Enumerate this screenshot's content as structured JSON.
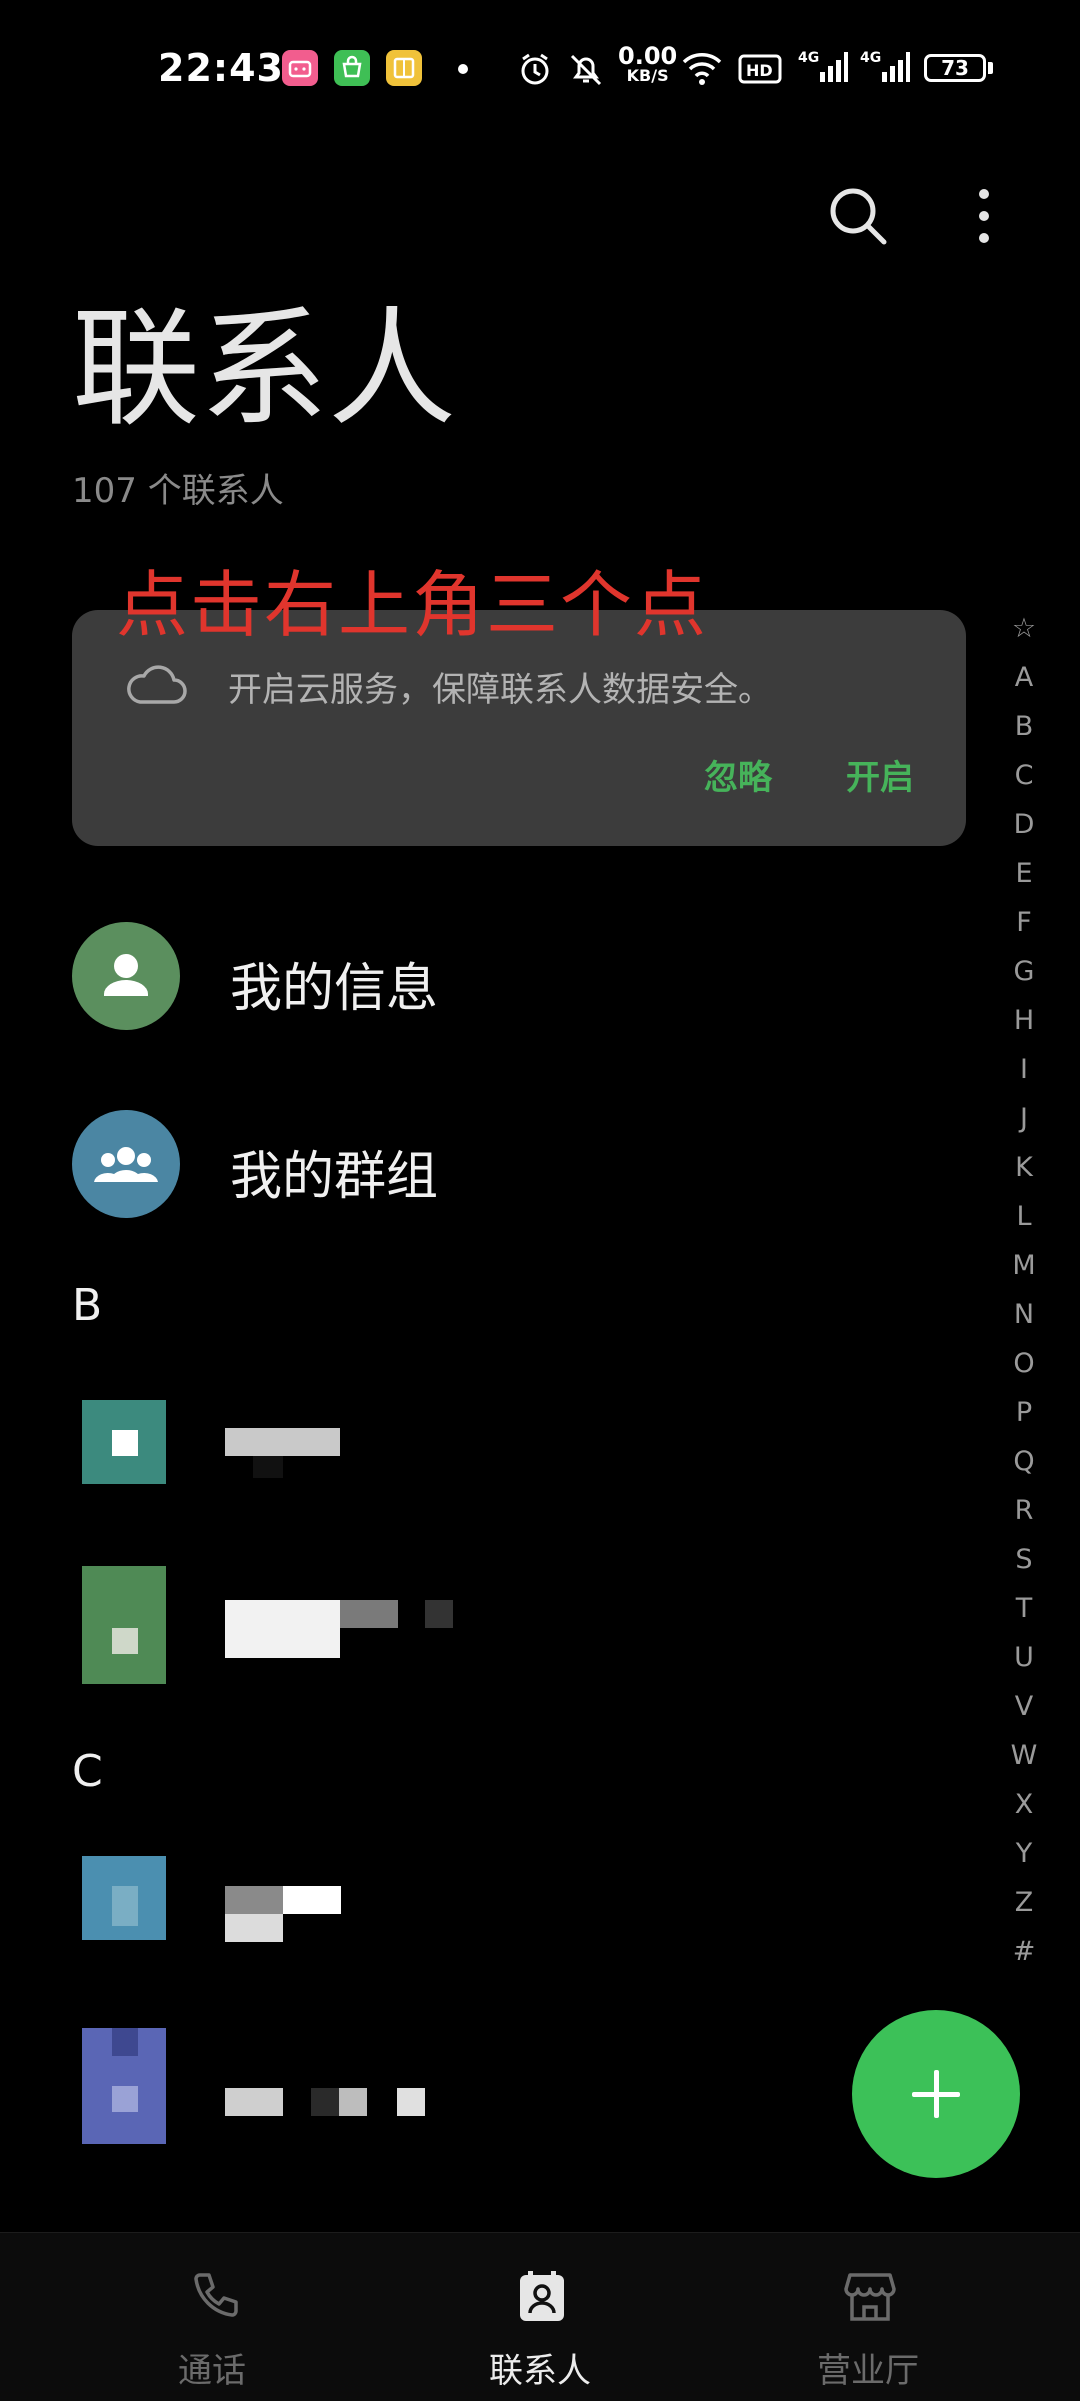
{
  "status_bar": {
    "time": "22:43",
    "net_speed_value": "0.00",
    "net_speed_unit": "KB/S",
    "signal_1": "4G",
    "signal_2": "4G",
    "hd_badge": "HD",
    "battery": "73"
  },
  "header": {
    "title": "联系人",
    "contact_count": "107 个联系人"
  },
  "overlay_hint": "点击右上角三个点",
  "cloud_card": {
    "message": "开启云服务，保障联系人数据安全。",
    "ignore_label": "忽略",
    "enable_label": "开启"
  },
  "list": {
    "my_info": "我的信息",
    "my_groups": "我的群组",
    "section_b": "B",
    "section_c": "C"
  },
  "index_letters": [
    "☆",
    "A",
    "B",
    "C",
    "D",
    "E",
    "F",
    "G",
    "H",
    "I",
    "J",
    "K",
    "L",
    "M",
    "N",
    "O",
    "P",
    "Q",
    "R",
    "S",
    "T",
    "U",
    "V",
    "W",
    "X",
    "Y",
    "Z",
    "#"
  ],
  "bottom_nav": {
    "calls": "通话",
    "contacts": "联系人",
    "hall": "营业厅"
  },
  "colors": {
    "accent_green": "#3cc158",
    "card_button_green": "#46b35a",
    "overlay_red": "#e0352d",
    "card_background": "#3c3c3c"
  }
}
